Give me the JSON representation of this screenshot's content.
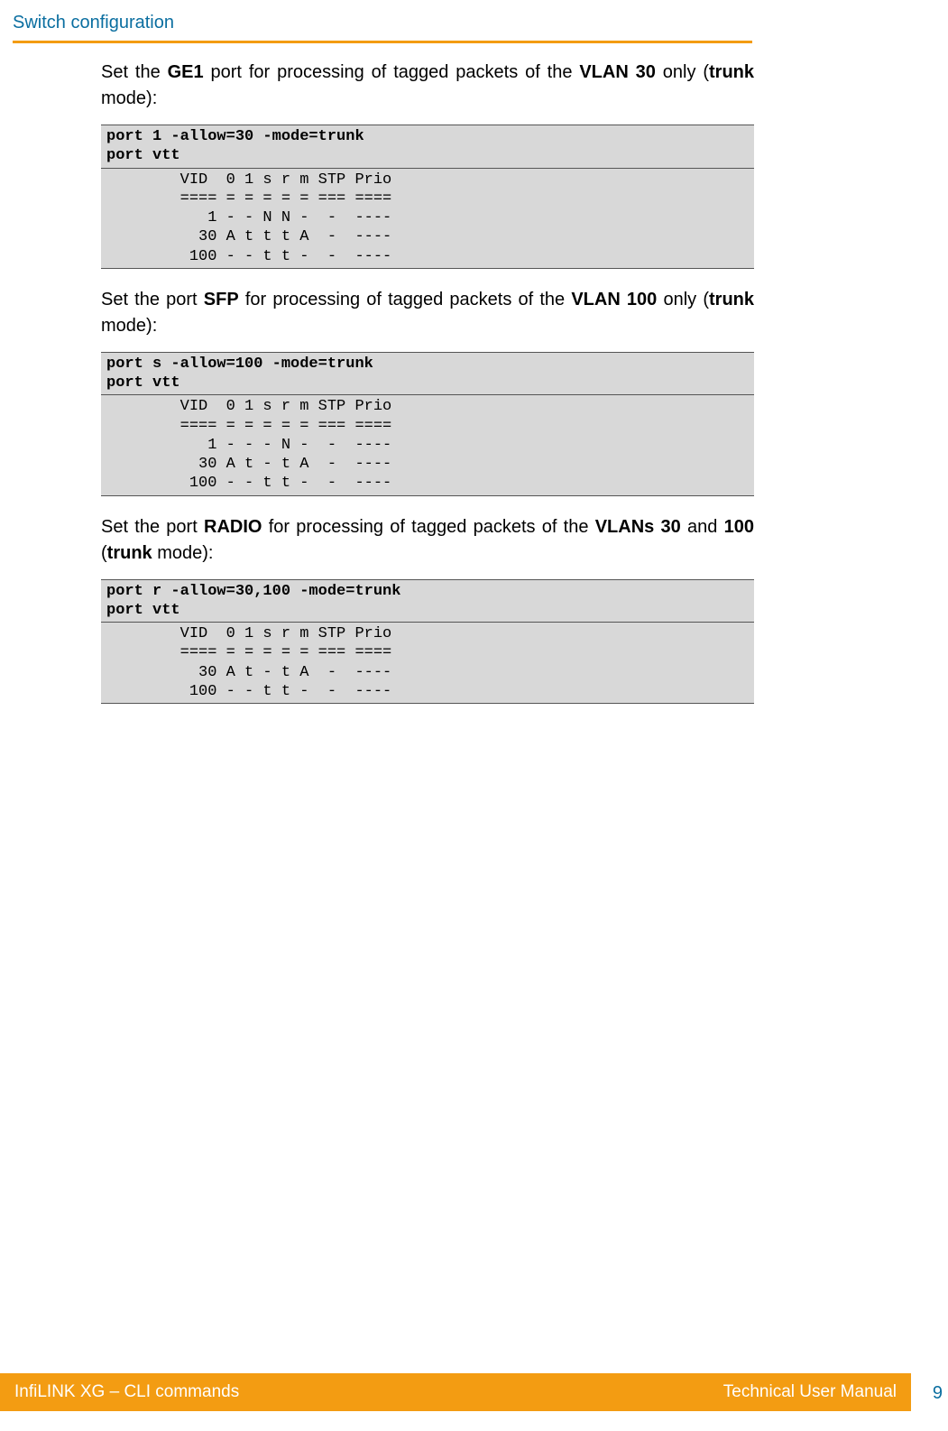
{
  "header": {
    "section_title": "Switch configuration"
  },
  "body": {
    "para1_pre": "Set the ",
    "para1_b1": "GE1",
    "para1_mid": " port for processing of tagged packets of the ",
    "para1_b2": "VLAN 30",
    "para1_post": " only (",
    "para1_b3": "trunk",
    "para1_end": " mode):",
    "code1_cmd": "port 1 -allow=30 -mode=trunk\nport vtt",
    "code1_out": "        VID  0 1 s r m STP Prio\n        ==== = = = = = === ====\n           1 - - N N -  -  ----\n          30 A t t t A  -  ----\n         100 - - t t -  -  ----",
    "para2_pre": "Set the port ",
    "para2_b1": "SFP",
    "para2_mid": " for processing of tagged packets of the ",
    "para2_b2": "VLAN 100",
    "para2_post": " only (",
    "para2_b3": "trunk",
    "para2_end": " mode):",
    "code2_cmd": "port s -allow=100 -mode=trunk\nport vtt",
    "code2_out": "        VID  0 1 s r m STP Prio\n        ==== = = = = = === ====\n           1 - - - N -  -  ----\n          30 A t - t A  -  ----\n         100 - - t t -  -  ----",
    "para3_pre": "Set the port ",
    "para3_b1": "RADIO",
    "para3_mid": " for processing of tagged packets of the ",
    "para3_b2": "VLANs 30",
    "para3_and": " and ",
    "para3_b3": "100",
    "para3_post": " (",
    "para3_b4": "trunk",
    "para3_end": " mode):",
    "code3_cmd": "port r -allow=30,100 -mode=trunk\nport vtt",
    "code3_out": "        VID  0 1 s r m STP Prio\n        ==== = = = = = === ====\n          30 A t - t A  -  ----\n         100 - - t t -  -  ----"
  },
  "footer": {
    "left": "InfiLINK XG – CLI commands",
    "right": "Technical User Manual",
    "page_number": "9"
  }
}
